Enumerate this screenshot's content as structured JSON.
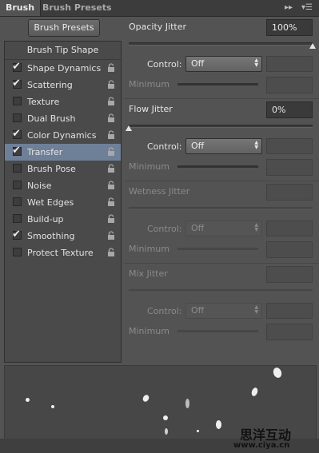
{
  "tabs": [
    {
      "label": "Brush"
    },
    {
      "label": "Brush Presets"
    }
  ],
  "panel_icons": {
    "forward": "double-chevron-right-icon",
    "menu": "panel-menu-icon"
  },
  "brush_presets_button": "Brush Presets",
  "sidebar": {
    "header": "Brush Tip Shape",
    "items": [
      {
        "label": "Shape Dynamics",
        "checked": true,
        "selected": false
      },
      {
        "label": "Scattering",
        "checked": true,
        "selected": false
      },
      {
        "label": "Texture",
        "checked": false,
        "selected": false
      },
      {
        "label": "Dual Brush",
        "checked": false,
        "selected": false
      },
      {
        "label": "Color Dynamics",
        "checked": true,
        "selected": false
      },
      {
        "label": "Transfer",
        "checked": true,
        "selected": true
      },
      {
        "label": "Brush Pose",
        "checked": false,
        "selected": false
      },
      {
        "label": "Noise",
        "checked": false,
        "selected": false
      },
      {
        "label": "Wet Edges",
        "checked": false,
        "selected": false
      },
      {
        "label": "Build-up",
        "checked": false,
        "selected": false
      },
      {
        "label": "Smoothing",
        "checked": true,
        "selected": false
      },
      {
        "label": "Protect Texture",
        "checked": false,
        "selected": false
      }
    ]
  },
  "sections": [
    {
      "title": "Opacity Jitter",
      "value": "100%",
      "slider_fraction": 1.0,
      "enabled": true,
      "control_label": "Control:",
      "control_value": "Off",
      "minimum_label": "Minimum"
    },
    {
      "title": "Flow Jitter",
      "value": "0%",
      "slider_fraction": 0.0,
      "enabled": true,
      "control_label": "Control:",
      "control_value": "Off",
      "minimum_label": "Minimum"
    },
    {
      "title": "Wetness Jitter",
      "value": "",
      "enabled": false,
      "control_label": "Control:",
      "control_value": "Off",
      "minimum_label": "Minimum"
    },
    {
      "title": "Mix Jitter",
      "value": "",
      "enabled": false,
      "control_label": "Control:",
      "control_value": "Off",
      "minimum_label": "Minimum"
    }
  ],
  "watermark": {
    "line1": "思洋互动",
    "line2": "www.ciya.cn"
  }
}
